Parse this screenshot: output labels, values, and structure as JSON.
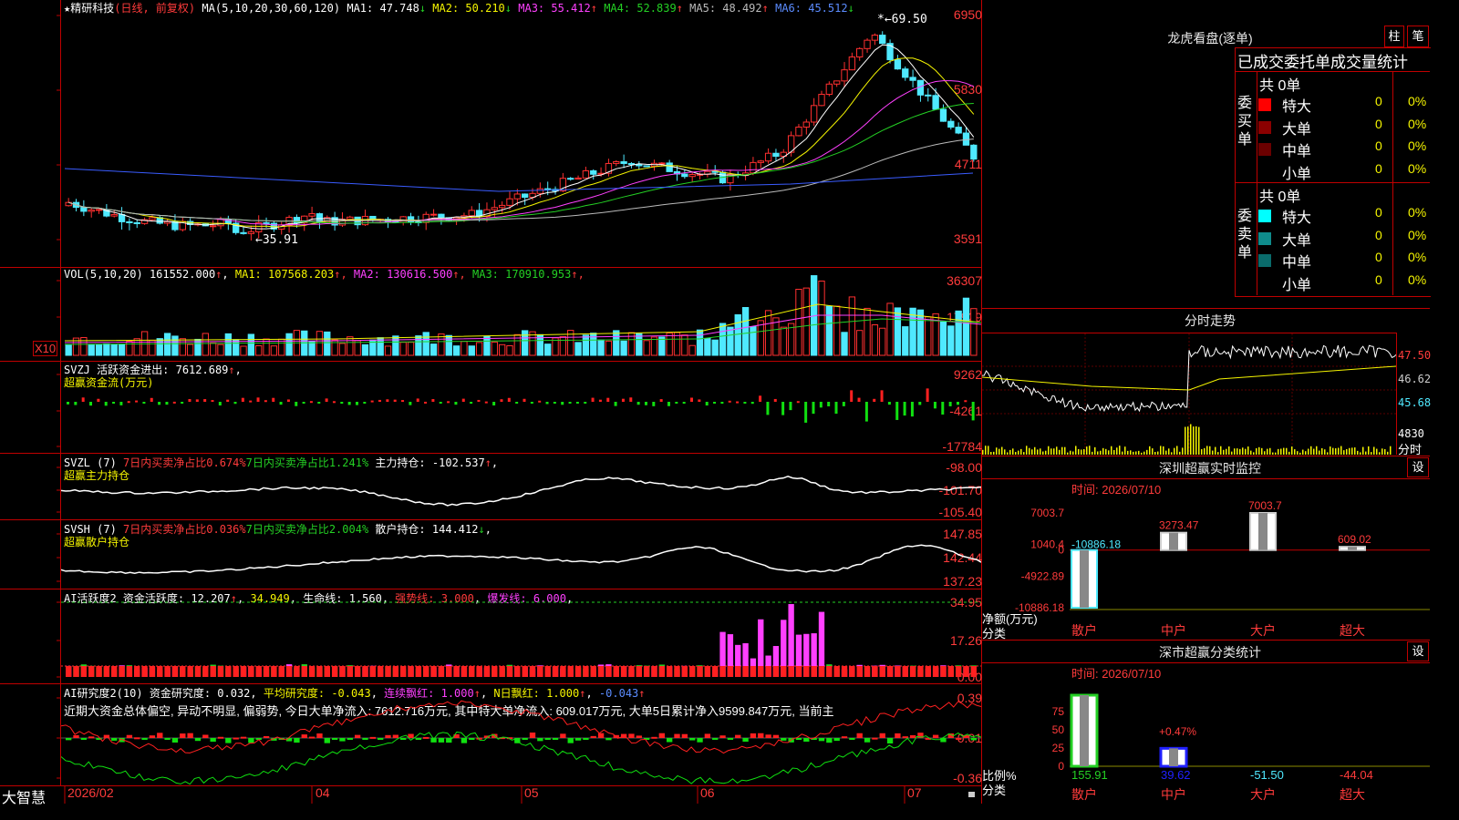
{
  "main": {
    "header": {
      "name": "精研科技",
      "period": "(日线, 前复权)",
      "ma_label": "MA(5,10,20,30,60,120)",
      "ma": [
        {
          "label": "MA1:",
          "value": "47.748",
          "arrow": "↓",
          "color": "#ffffff"
        },
        {
          "label": "MA2:",
          "value": "50.210",
          "arrow": "↓",
          "color": "#f4f400"
        },
        {
          "label": "MA3:",
          "value": "55.412",
          "arrow": "↑",
          "color": "#ff40ff"
        },
        {
          "label": "MA4:",
          "value": "52.839",
          "arrow": "↑",
          "color": "#24d024"
        },
        {
          "label": "MA5:",
          "value": "48.492",
          "arrow": "↑",
          "color": "#bbbbbb"
        },
        {
          "label": "MA6:",
          "value": "45.512",
          "arrow": "↓",
          "color": "#5b8cff"
        }
      ]
    },
    "yaxis": [
      "6950",
      "5830",
      "4711",
      "3591"
    ],
    "high_label": "69.50",
    "low_label": "←35.91"
  },
  "vol": {
    "label": "VOL(5,10,20)",
    "value": "161552.000",
    "ma": [
      {
        "label": "MA1:",
        "value": "107568.203",
        "color": "#f4f400"
      },
      {
        "label": "MA2:",
        "value": "130616.500",
        "color": "#ff40ff"
      },
      {
        "label": "MA3:",
        "value": "170910.953",
        "color": "#24d024"
      }
    ],
    "yaxis": [
      "36307",
      "17929"
    ],
    "unit": "X10"
  },
  "svzj": {
    "label": "SVZJ",
    "title": "活跃资金进出:",
    "value": "7612.689",
    "subtitle": "超赢资金流(万元)",
    "yaxis": [
      "9262",
      "-4261",
      "-17784"
    ]
  },
  "svzl": {
    "label": "SVZL (7)",
    "t1": "7日内买卖净占比0.674%",
    "t2": "7日内买卖净占比1.241%",
    "t3": "主力持仓:",
    "value": "-102.537",
    "subtitle": "超赢主力持仓",
    "yaxis": [
      "-98.00",
      "-101.70",
      "-105.40"
    ]
  },
  "svsh": {
    "label": "SVSH (7)",
    "t1": "7日内买卖净占比0.036%",
    "t2": "7日内买卖净占比2.004%",
    "t3": "散户持仓:",
    "value": "144.412",
    "subtitle": "超赢散户持仓",
    "yaxis": [
      "147.85",
      "142.44",
      "137.23"
    ]
  },
  "ai1": {
    "label": "AI活跃度2",
    "t1": "资金活跃度:",
    "v1": "12.207",
    "v2": "34.949",
    "t3": "生命线:",
    "v3": "1.560",
    "t4": "强势线:",
    "v4": "3.000",
    "t5": "爆发线:",
    "v5": "6.000",
    "yaxis": [
      "34.95",
      "17.26",
      "0.00"
    ]
  },
  "ai2": {
    "label": "AI研究度2(10)",
    "t1": "资金研究度:",
    "v1": "0.032",
    "t2": "平均研究度:",
    "v2": "-0.043",
    "t3": "连续飘红:",
    "v3": "1.000",
    "t4": "N日飘红:",
    "v4": "1.000",
    "v5": "-0.043",
    "commentary": "近期大资金总体偏空, 异动不明显, 偏弱势, 今日大单净流入: 7612.716万元, 其中特大单净流入: 609.017万元, 大单5日累计净入9599.847万元, 当前主",
    "yaxis": [
      "0.39",
      "0.01",
      "-0.36"
    ]
  },
  "xaxis": {
    "brand": "大智慧",
    "dates": [
      "2026/02",
      "04",
      "05",
      "06",
      "07"
    ]
  },
  "longhu": {
    "title": "龙虎看盘(逐单)",
    "btn_bar": "柱",
    "btn_pen": "笔",
    "tabs_header": "已成交委托单成交量统计",
    "buy_label": "委买单",
    "sell_label": "委卖单",
    "buy_total": "共 0单",
    "sell_total": "共 0单",
    "buy_rows": [
      {
        "name": "特大",
        "count": "0",
        "pct": "0%",
        "color": "#ff0000"
      },
      {
        "name": "大单",
        "count": "0",
        "pct": "0%",
        "color": "#8b0000"
      },
      {
        "name": "中单",
        "count": "0",
        "pct": "0%",
        "color": "#6b0000"
      },
      {
        "name": "小单",
        "count": "0",
        "pct": "0%",
        "color": "#000000"
      }
    ],
    "sell_rows": [
      {
        "name": "特大",
        "count": "0",
        "pct": "0%",
        "color": "#00ffff"
      },
      {
        "name": "大单",
        "count": "0",
        "pct": "0%",
        "color": "#0f8b8b"
      },
      {
        "name": "中单",
        "count": "0",
        "pct": "0%",
        "color": "#0a6b6b"
      },
      {
        "name": "小单",
        "count": "0",
        "pct": "0%",
        "color": "#000000"
      }
    ]
  },
  "intraday": {
    "title": "分时走势",
    "yaxis": [
      "47.50",
      "46.62",
      "45.68"
    ],
    "vol_label": "4830",
    "time_label": "分时"
  },
  "realtime": {
    "title": "深圳超赢实时监控",
    "btn": "设",
    "time": "时间: 2026/07/10",
    "yaxis": [
      "7003.7",
      "1040.4",
      "0",
      "-4922.89",
      "-10886.18"
    ],
    "values": [
      {
        "cat": "散户",
        "label": "-10886.18",
        "value": -10886.18
      },
      {
        "cat": "中户",
        "label": "3273.47",
        "value": 3273.47
      },
      {
        "cat": "大户",
        "label": "7003.7",
        "value": 7003.7
      },
      {
        "cat": "超大",
        "label": "609.02",
        "value": 609.02
      }
    ],
    "ylabel": "净额(万元)",
    "xlabel": "分类"
  },
  "classify": {
    "title": "深市超赢分类统计",
    "btn": "设",
    "time": "时间: 2026/07/10",
    "yaxis": [
      "75",
      "50",
      "25",
      "0"
    ],
    "annot": "+0.47%",
    "values": [
      {
        "cat": "散户",
        "label": "155.91"
      },
      {
        "cat": "中户",
        "label": "39.62"
      },
      {
        "cat": "大户",
        "label": "-51.50"
      },
      {
        "cat": "超大",
        "label": "-44.04"
      }
    ],
    "ylabel": "比例%",
    "xlabel": "分类"
  },
  "chart_data": [
    {
      "type": "bar",
      "title": "深圳超赢实时监控",
      "categories": [
        "散户",
        "中户",
        "大户",
        "超大"
      ],
      "values": [
        -10886.18,
        3273.47,
        7003.7,
        609.02
      ],
      "ylabel": "净额(万元)",
      "xlabel": "分类",
      "ylim": [
        -10886.18,
        7003.7
      ]
    },
    {
      "type": "bar",
      "title": "深市超赢分类统计",
      "categories": [
        "散户",
        "中户",
        "大户",
        "超大"
      ],
      "values": [
        155.91,
        39.62,
        -51.5,
        -44.04
      ],
      "ylabel": "比例%",
      "xlabel": "分类",
      "ylim": [
        0,
        75
      ]
    }
  ]
}
